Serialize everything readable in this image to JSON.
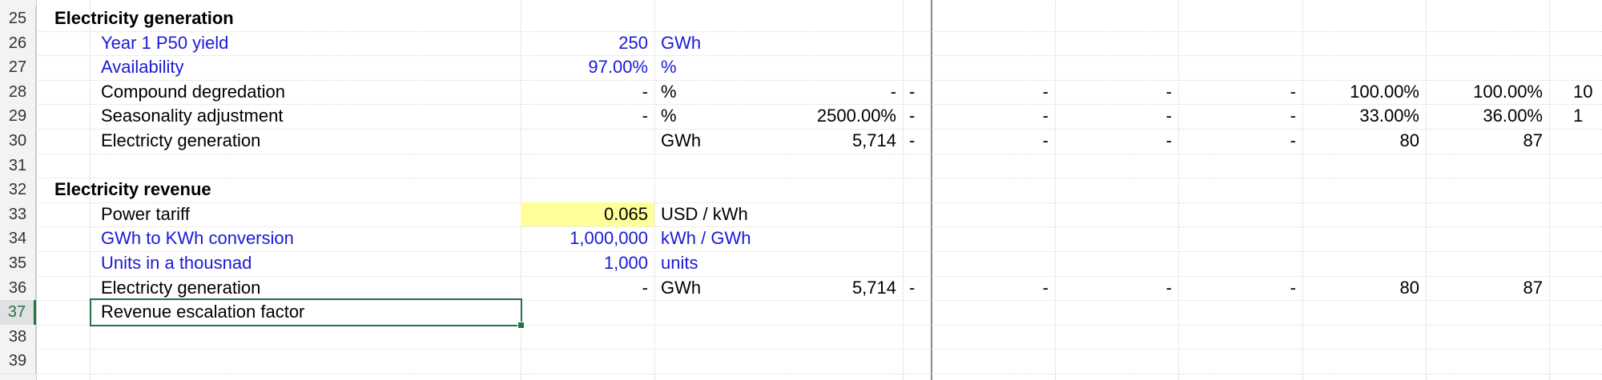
{
  "rows": [
    {
      "num": "25",
      "label": "Electricity generation",
      "style": "bold-section",
      "cells": {}
    },
    {
      "num": "26",
      "label": "Year 1 P50 yield",
      "style": "blue",
      "input": "250",
      "unit": "GWh",
      "cells": {}
    },
    {
      "num": "27",
      "label": "Availability",
      "style": "blue",
      "input": "97.00%",
      "unit": "%",
      "cells": {}
    },
    {
      "num": "28",
      "label": "Compound degredation",
      "style": "normal",
      "input": "-",
      "unit": "%",
      "total": "-",
      "c1": "-",
      "c2": "-",
      "c3": "-",
      "c4": "-",
      "c5": "100.00%",
      "c6": "100.00%",
      "c7": "10"
    },
    {
      "num": "29",
      "label": "Seasonality adjustment",
      "style": "normal",
      "input": "-",
      "unit": "%",
      "total": "2500.00%",
      "c1": "-",
      "c2": "-",
      "c3": "-",
      "c4": "-",
      "c5": "33.00%",
      "c6": "36.00%",
      "c7": "1"
    },
    {
      "num": "30",
      "label": "Electricty generation",
      "style": "normal",
      "input": "",
      "unit": "GWh",
      "total": "5,714",
      "c1": "-",
      "c2": "-",
      "c3": "-",
      "c4": "-",
      "c5": "80",
      "c6": "87",
      "c7": ""
    },
    {
      "num": "31",
      "label": "",
      "style": "normal"
    },
    {
      "num": "32",
      "label": "Electricity revenue",
      "style": "bold-section"
    },
    {
      "num": "33",
      "label": "Power tariff",
      "style": "normal",
      "input": "0.065",
      "unit": "USD / kWh",
      "highlight": true
    },
    {
      "num": "34",
      "label": "GWh to KWh conversion",
      "style": "blue",
      "input": "1,000,000",
      "unit": "kWh / GWh"
    },
    {
      "num": "35",
      "label": "Units in a thousnad",
      "style": "blue",
      "input": "1,000",
      "unit": "units"
    },
    {
      "num": "36",
      "label": "Electricty generation",
      "style": "normal",
      "input": "-",
      "unit": "GWh",
      "total": "5,714",
      "c1": "-",
      "c2": "-",
      "c3": "-",
      "c4": "-",
      "c5": "80",
      "c6": "87",
      "c7": ""
    },
    {
      "num": "37",
      "label": "Revenue escalation factor",
      "style": "normal",
      "selected": true
    },
    {
      "num": "38",
      "label": "",
      "style": "normal"
    },
    {
      "num": "39",
      "label": "",
      "style": "normal"
    }
  ],
  "colors": {
    "input_blue": "#1a1ad6",
    "highlight": "#ffff99",
    "selection": "#217346"
  }
}
